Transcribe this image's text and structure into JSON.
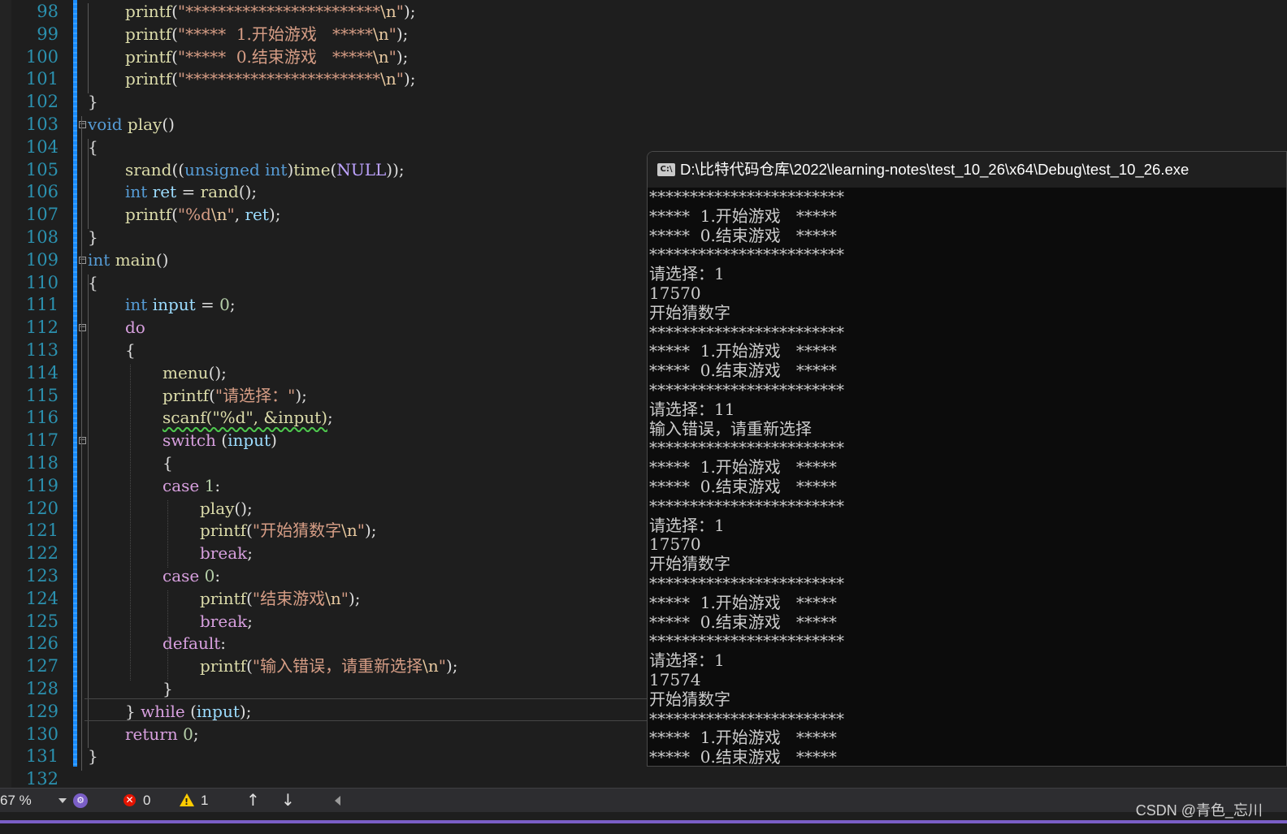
{
  "editor": {
    "line_numbers": [
      "98",
      "99",
      "100",
      "101",
      "102",
      "103",
      "104",
      "105",
      "106",
      "107",
      "108",
      "109",
      "110",
      "111",
      "112",
      "113",
      "114",
      "115",
      "116",
      "117",
      "118",
      "119",
      "120",
      "121",
      "122",
      "123",
      "124",
      "125",
      "126",
      "127",
      "128",
      "129",
      "130",
      "131",
      "132"
    ],
    "lines": [
      [
        [
          "fn",
          "printf"
        ],
        [
          "pun",
          "("
        ],
        [
          "str",
          "\"************************"
        ],
        [
          "esc",
          "\\n"
        ],
        [
          "str",
          "\""
        ],
        [
          "pun",
          ");"
        ]
      ],
      [
        [
          "fn",
          "printf"
        ],
        [
          "pun",
          "("
        ],
        [
          "str",
          "\"*****  1.开始游戏   *****"
        ],
        [
          "esc",
          "\\n"
        ],
        [
          "str",
          "\""
        ],
        [
          "pun",
          ");"
        ]
      ],
      [
        [
          "fn",
          "printf"
        ],
        [
          "pun",
          "("
        ],
        [
          "str",
          "\"*****  0.结束游戏   *****"
        ],
        [
          "esc",
          "\\n"
        ],
        [
          "str",
          "\""
        ],
        [
          "pun",
          ");"
        ]
      ],
      [
        [
          "fn",
          "printf"
        ],
        [
          "pun",
          "("
        ],
        [
          "str",
          "\"************************"
        ],
        [
          "esc",
          "\\n"
        ],
        [
          "str",
          "\""
        ],
        [
          "pun",
          ");"
        ]
      ],
      [
        [
          "pun",
          "}"
        ]
      ],
      [
        [
          "kw",
          "void"
        ],
        [
          "pun",
          " "
        ],
        [
          "fn",
          "play"
        ],
        [
          "pun",
          "()"
        ]
      ],
      [
        [
          "pun",
          "{"
        ]
      ],
      [
        [
          "fn",
          "srand"
        ],
        [
          "pun",
          "(("
        ],
        [
          "kw",
          "unsigned"
        ],
        [
          "pun",
          " "
        ],
        [
          "kw",
          "int"
        ],
        [
          "pun",
          ")"
        ],
        [
          "fn",
          "time"
        ],
        [
          "pun",
          "("
        ],
        [
          "mac",
          "NULL"
        ],
        [
          "pun",
          "));"
        ]
      ],
      [
        [
          "kw",
          "int"
        ],
        [
          "pun",
          " "
        ],
        [
          "var",
          "ret"
        ],
        [
          "pun",
          " = "
        ],
        [
          "fn",
          "rand"
        ],
        [
          "pun",
          "();"
        ]
      ],
      [
        [
          "fn",
          "printf"
        ],
        [
          "pun",
          "("
        ],
        [
          "str",
          "\"%d"
        ],
        [
          "esc",
          "\\n"
        ],
        [
          "str",
          "\""
        ],
        [
          "pun",
          ", "
        ],
        [
          "var",
          "ret"
        ],
        [
          "pun",
          ");"
        ]
      ],
      [
        [
          "pun",
          "}"
        ]
      ],
      [
        [
          "kw",
          "int"
        ],
        [
          "pun",
          " "
        ],
        [
          "fn",
          "main"
        ],
        [
          "pun",
          "()"
        ]
      ],
      [
        [
          "pun",
          "{"
        ]
      ],
      [
        [
          "kw",
          "int"
        ],
        [
          "pun",
          " "
        ],
        [
          "var",
          "input"
        ],
        [
          "pun",
          " = "
        ],
        [
          "num",
          "0"
        ],
        [
          "pun",
          ";"
        ]
      ],
      [
        [
          "ctl",
          "do"
        ]
      ],
      [
        [
          "pun",
          "{"
        ]
      ],
      [
        [
          "fn",
          "menu"
        ],
        [
          "pun",
          "();"
        ]
      ],
      [
        [
          "fn",
          "printf"
        ],
        [
          "pun",
          "("
        ],
        [
          "str",
          "\"请选择：\""
        ],
        [
          "pun",
          ");"
        ]
      ],
      [
        [
          "sq",
          "scanf(\"%d\", &input)"
        ],
        [
          "pun",
          ";"
        ]
      ],
      [
        [
          "ctl",
          "switch"
        ],
        [
          "pun",
          " ("
        ],
        [
          "var",
          "input"
        ],
        [
          "pun",
          ")"
        ]
      ],
      [
        [
          "pun",
          "{"
        ]
      ],
      [
        [
          "ctl",
          "case"
        ],
        [
          "pun",
          " "
        ],
        [
          "num",
          "1"
        ],
        [
          "pun",
          ":"
        ]
      ],
      [
        [
          "fn",
          "play"
        ],
        [
          "pun",
          "();"
        ]
      ],
      [
        [
          "fn",
          "printf"
        ],
        [
          "pun",
          "("
        ],
        [
          "str",
          "\"开始猜数字"
        ],
        [
          "esc",
          "\\n"
        ],
        [
          "str",
          "\""
        ],
        [
          "pun",
          ");"
        ]
      ],
      [
        [
          "ctl",
          "break"
        ],
        [
          "pun",
          ";"
        ]
      ],
      [
        [
          "ctl",
          "case"
        ],
        [
          "pun",
          " "
        ],
        [
          "num",
          "0"
        ],
        [
          "pun",
          ":"
        ]
      ],
      [
        [
          "fn",
          "printf"
        ],
        [
          "pun",
          "("
        ],
        [
          "str",
          "\"结束游戏"
        ],
        [
          "esc",
          "\\n"
        ],
        [
          "str",
          "\""
        ],
        [
          "pun",
          ");"
        ]
      ],
      [
        [
          "ctl",
          "break"
        ],
        [
          "pun",
          ";"
        ]
      ],
      [
        [
          "ctl",
          "default"
        ],
        [
          "pun",
          ":"
        ]
      ],
      [
        [
          "fn",
          "printf"
        ],
        [
          "pun",
          "("
        ],
        [
          "str",
          "\"输入错误，请重新选择"
        ],
        [
          "esc",
          "\\n"
        ],
        [
          "str",
          "\""
        ],
        [
          "pun",
          ");"
        ]
      ],
      [
        [
          "pun",
          "}"
        ]
      ],
      [
        [
          "pun",
          "} "
        ],
        [
          "ctl",
          "while"
        ],
        [
          "pun",
          " ("
        ],
        [
          "var",
          "input"
        ],
        [
          "pun",
          ");"
        ]
      ],
      [
        [
          "ctl",
          "return"
        ],
        [
          "pun",
          " "
        ],
        [
          "num",
          "0"
        ],
        [
          "pun",
          ";"
        ]
      ],
      [
        [
          "pun",
          "}"
        ]
      ],
      []
    ]
  },
  "console": {
    "title": "D:\\比特代码仓库\\2022\\learning-notes\\test_10_26\\x64\\Debug\\test_10_26.exe",
    "icon": "console-app-icon",
    "icon_text": "C:\\",
    "lines": [
      "************************",
      "*****  1.开始游戏   *****",
      "*****  0.结束游戏   *****",
      "************************",
      "请选择：1",
      "17570",
      "开始猜数字",
      "************************",
      "*****  1.开始游戏   *****",
      "*****  0.结束游戏   *****",
      "************************",
      "请选择：11",
      "输入错误，请重新选择",
      "************************",
      "*****  1.开始游戏   *****",
      "*****  0.结束游戏   *****",
      "************************",
      "请选择：1",
      "17570",
      "开始猜数字",
      "************************",
      "*****  1.开始游戏   *****",
      "*****  0.结束游戏   *****",
      "************************",
      "请选择：1",
      "17574",
      "开始猜数字",
      "************************",
      "*****  1.开始游戏   *****",
      "*****  0.结束游戏   *****"
    ]
  },
  "statusbar": {
    "zoom": "67 %",
    "errors": "0",
    "warnings": "1",
    "up_arrow": "↑",
    "down_arrow": "↓",
    "error_glyph": "✕",
    "warning_glyph": "!"
  },
  "watermark": "CSDN @青色_忘川",
  "colors": {
    "editor_bg": "#1e1e1e",
    "line_number": "#2b91af",
    "keyword": "#569cd6",
    "control": "#d8a0df",
    "function": "#dcdcaa",
    "string": "#d69d85",
    "variable": "#9cdcfe",
    "console_bg": "#0c0c0c",
    "accent": "#7b5fc7"
  }
}
